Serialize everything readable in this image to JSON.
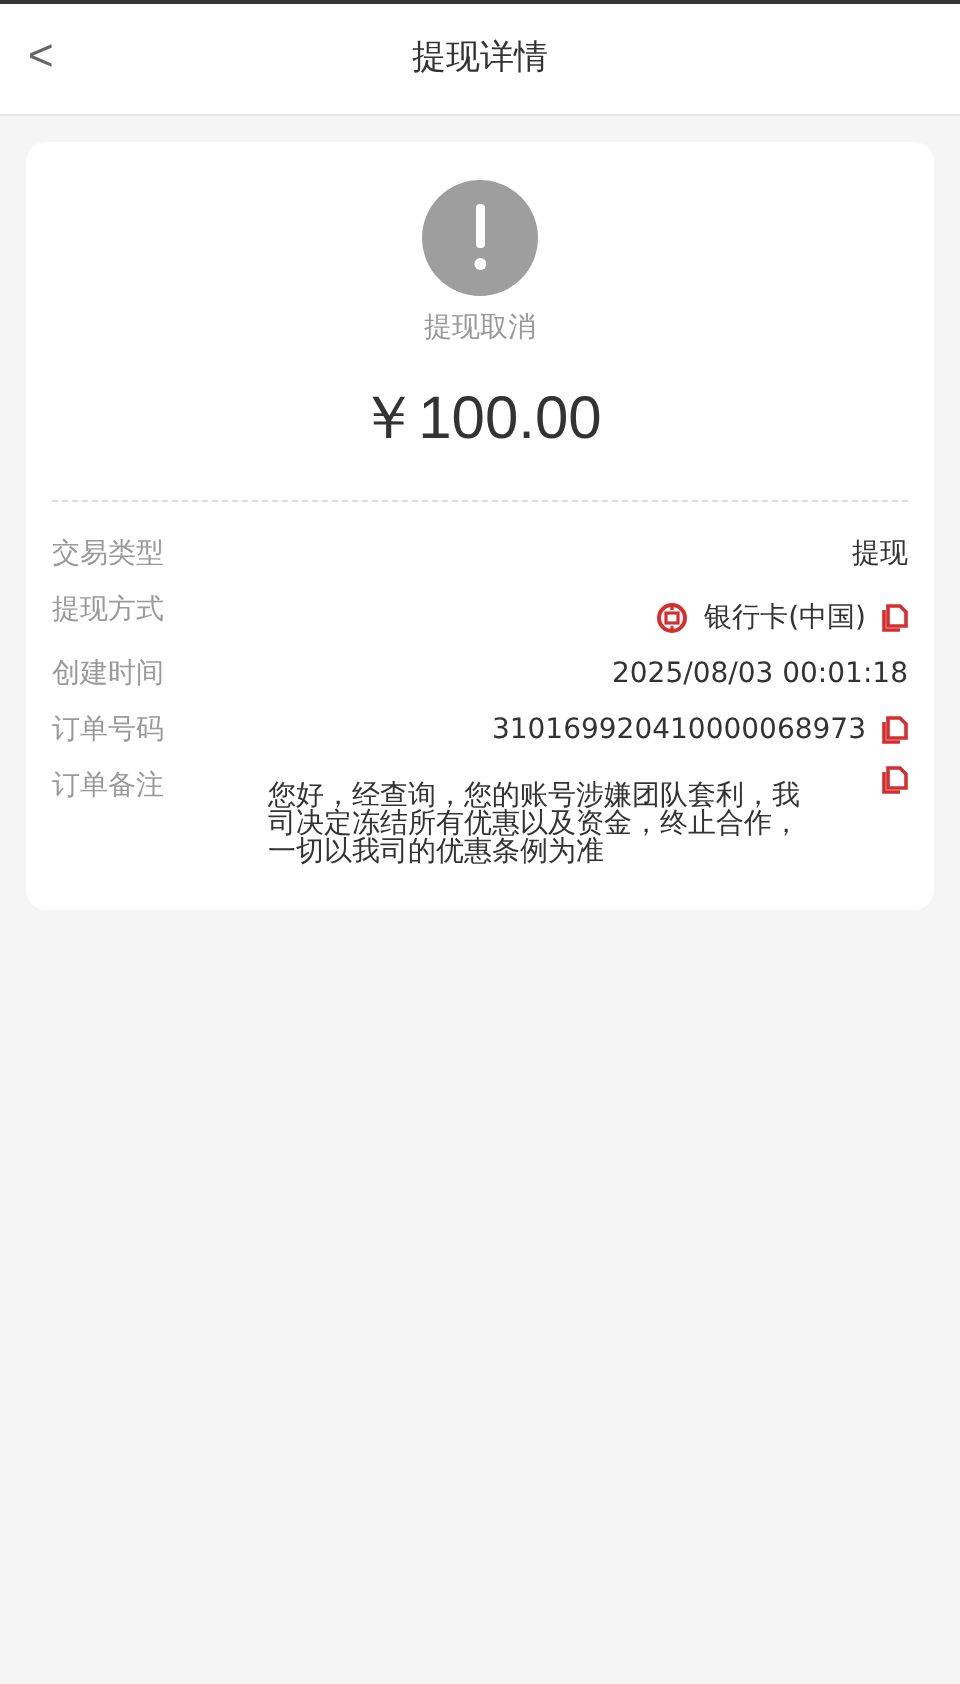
{
  "header": {
    "back": "<",
    "title": "提现详情"
  },
  "status": {
    "label": "提现取消",
    "amount": "￥100.00"
  },
  "rows": [
    {
      "kind": "plain",
      "label": "交易类型",
      "value": "提现"
    },
    {
      "kind": "bank",
      "label": "提现方式",
      "value": "银行卡(中国)"
    },
    {
      "kind": "plain",
      "label": "创建时间",
      "value": "2025/08/03 00:01:18"
    },
    {
      "kind": "copyable",
      "label": "订单号码",
      "value": "310169920410000068973"
    },
    {
      "kind": "note",
      "label": "订单备注",
      "value": "您好，经查询，您的账号涉嫌团队套利，我司决定冻结所有优惠以及资金，终止合作，一切以我司的优惠条例为准"
    }
  ]
}
